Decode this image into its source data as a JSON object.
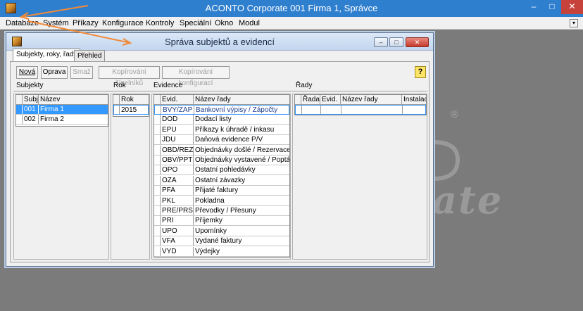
{
  "app": {
    "title": "ACONTO Corporate 001 Firma 1, Správce",
    "min_glyph": "–",
    "max_glyph": "□",
    "close_glyph": "✕"
  },
  "menu": {
    "items": [
      "Databáze",
      "Systém",
      "Příkazy",
      "Konfigurace",
      "Kontroly",
      "Speciální",
      "Okno",
      "Modul"
    ],
    "right_glyph": "▾"
  },
  "child": {
    "title": "Správa subjektů a evidencí",
    "tabs": [
      {
        "label": "Subjekty, roky, řady",
        "active": true
      },
      {
        "label": "Přehled",
        "active": false
      }
    ],
    "toolbar": {
      "buttons": [
        {
          "label": "Nová",
          "enabled": true
        },
        {
          "label": "Oprava",
          "enabled": true
        },
        {
          "label": "Smaž",
          "enabled": false
        },
        {
          "label": "Kopírování číselníků",
          "enabled": false
        },
        {
          "label": "Kopírování konfigurací",
          "enabled": false
        }
      ],
      "help": "?"
    },
    "subjekty": {
      "title": "Subjekty",
      "columns": [
        "Subj",
        "Název"
      ],
      "rows": [
        {
          "code": "001",
          "name": "Firma 1",
          "selected": true
        },
        {
          "code": "002",
          "name": "Firma 2",
          "selected": false
        }
      ]
    },
    "rok": {
      "title": "Rok",
      "columns": [
        "Rok"
      ],
      "rows": [
        {
          "value": "2015",
          "selected": true
        }
      ]
    },
    "evidence": {
      "title": "Evidence",
      "columns": [
        "Evid.",
        "Název řady"
      ],
      "rows": [
        {
          "code": "BVY/ZAP",
          "name": "Bankovní výpisy / Zápočty",
          "selected": true
        },
        {
          "code": "DOD",
          "name": "Dodací listy",
          "selected": false
        },
        {
          "code": "EPU",
          "name": "Příkazy k úhradě / inkasu",
          "selected": false
        },
        {
          "code": "JDU",
          "name": "Daňová evidence P/V",
          "selected": false
        },
        {
          "code": "OBD/REZ",
          "name": "Objednávky došlé / Rezervace",
          "selected": false
        },
        {
          "code": "OBV/PPT",
          "name": "Objednávky vystavené / Poptávky",
          "selected": false
        },
        {
          "code": "OPO",
          "name": "Ostatní pohledávky",
          "selected": false
        },
        {
          "code": "OZA",
          "name": "Ostatní závazky",
          "selected": false
        },
        {
          "code": "PFA",
          "name": "Přijaté faktury",
          "selected": false
        },
        {
          "code": "PKL",
          "name": "Pokladna",
          "selected": false
        },
        {
          "code": "PRE/PRS",
          "name": "Převodky / Přesuny",
          "selected": false
        },
        {
          "code": "PRI",
          "name": "Příjemky",
          "selected": false
        },
        {
          "code": "UPO",
          "name": "Upomínky",
          "selected": false
        },
        {
          "code": "VFA",
          "name": "Vydané faktury",
          "selected": false
        },
        {
          "code": "VYD",
          "name": "Výdejky",
          "selected": false
        }
      ]
    },
    "rady": {
      "title": "Řady",
      "columns": [
        "Řada",
        "Evid.",
        "Název řady",
        "Instalace"
      ]
    }
  },
  "background": {
    "logo_text": "ate",
    "registered": "®"
  }
}
